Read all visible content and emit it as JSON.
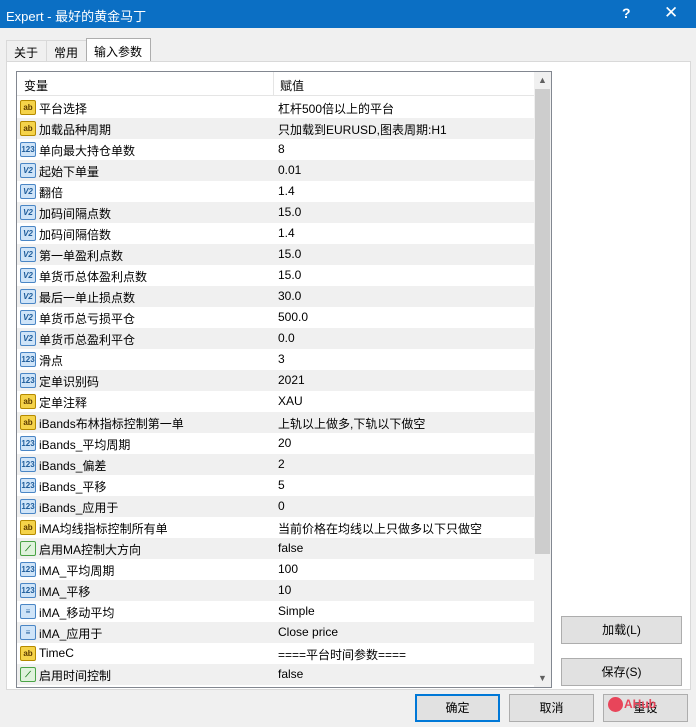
{
  "window": {
    "title": "Expert - 最好的黄金马丁",
    "help": "?",
    "close": "✕"
  },
  "tabs": [
    "关于",
    "常用",
    "输入参数"
  ],
  "grid": {
    "col_variable": "变量",
    "col_value": "赋值",
    "rows": [
      {
        "icon": "string-icon",
        "type": "str",
        "glyph": "ab",
        "name": "平台选择",
        "value": "杠杆500倍以上的平台"
      },
      {
        "icon": "string-icon",
        "type": "str",
        "glyph": "ab",
        "name": "加载品种周期",
        "value": "只加载到EURUSD,图表周期:H1"
      },
      {
        "icon": "integer-icon",
        "type": "int",
        "glyph": "123",
        "name": "单向最大持仓单数",
        "value": "8"
      },
      {
        "icon": "double-icon",
        "type": "dbl",
        "glyph": "V2",
        "name": "起始下单量",
        "value": "0.01"
      },
      {
        "icon": "double-icon",
        "type": "dbl",
        "glyph": "V2",
        "name": "翻倍",
        "value": "1.4"
      },
      {
        "icon": "double-icon",
        "type": "dbl",
        "glyph": "V2",
        "name": "加码间隔点数",
        "value": "15.0"
      },
      {
        "icon": "double-icon",
        "type": "dbl",
        "glyph": "V2",
        "name": "加码间隔倍数",
        "value": "1.4"
      },
      {
        "icon": "double-icon",
        "type": "dbl",
        "glyph": "V2",
        "name": "第一单盈利点数",
        "value": "15.0"
      },
      {
        "icon": "double-icon",
        "type": "dbl",
        "glyph": "V2",
        "name": "单货币总体盈利点数",
        "value": "15.0"
      },
      {
        "icon": "double-icon",
        "type": "dbl",
        "glyph": "V2",
        "name": "最后一单止损点数",
        "value": "30.0"
      },
      {
        "icon": "double-icon",
        "type": "dbl",
        "glyph": "V2",
        "name": "单货币总亏损平仓",
        "value": "500.0"
      },
      {
        "icon": "double-icon",
        "type": "dbl",
        "glyph": "V2",
        "name": "单货币总盈利平仓",
        "value": "0.0"
      },
      {
        "icon": "integer-icon",
        "type": "int",
        "glyph": "123",
        "name": "滑点",
        "value": "3"
      },
      {
        "icon": "integer-icon",
        "type": "int",
        "glyph": "123",
        "name": "定单识别码",
        "value": "2021"
      },
      {
        "icon": "string-icon",
        "type": "str",
        "glyph": "ab",
        "name": "定单注释",
        "value": "XAU"
      },
      {
        "icon": "string-icon",
        "type": "str",
        "glyph": "ab",
        "name": "iBands布林指标控制第一单",
        "value": "上轨以上做多,下轨以下做空"
      },
      {
        "icon": "integer-icon",
        "type": "int",
        "glyph": "123",
        "name": "iBands_平均周期",
        "value": "20"
      },
      {
        "icon": "integer-icon",
        "type": "int",
        "glyph": "123",
        "name": "iBands_偏差",
        "value": "2"
      },
      {
        "icon": "integer-icon",
        "type": "int",
        "glyph": "123",
        "name": "iBands_平移",
        "value": "5"
      },
      {
        "icon": "integer-icon",
        "type": "int",
        "glyph": "123",
        "name": "iBands_应用于",
        "value": "0"
      },
      {
        "icon": "string-icon",
        "type": "str",
        "glyph": "ab",
        "name": "iMA均线指标控制所有单",
        "value": "当前价格在均线以上只做多以下只做空"
      },
      {
        "icon": "bool-icon",
        "type": "bool",
        "glyph": "⟋",
        "name": "启用MA控制大方向",
        "value": "false"
      },
      {
        "icon": "integer-icon",
        "type": "int",
        "glyph": "123",
        "name": "iMA_平均周期",
        "value": "100"
      },
      {
        "icon": "integer-icon",
        "type": "int",
        "glyph": "123",
        "name": "iMA_平移",
        "value": "10"
      },
      {
        "icon": "enum-icon",
        "type": "enm",
        "glyph": "≡",
        "name": "iMA_移动平均",
        "value": "Simple"
      },
      {
        "icon": "enum-icon",
        "type": "enm",
        "glyph": "≡",
        "name": "iMA_应用于",
        "value": "Close price"
      },
      {
        "icon": "string-icon",
        "type": "str",
        "glyph": "ab",
        "name": "TimeC",
        "value": "====平台时间参数===="
      },
      {
        "icon": "bool-icon",
        "type": "bool",
        "glyph": "⟋",
        "name": "启用时间控制",
        "value": "false"
      }
    ]
  },
  "buttons": {
    "load": "加载(L)",
    "save": "保存(S)",
    "ok": "确定",
    "cancel": "取消",
    "reset": "重设"
  },
  "watermark": "AHub"
}
